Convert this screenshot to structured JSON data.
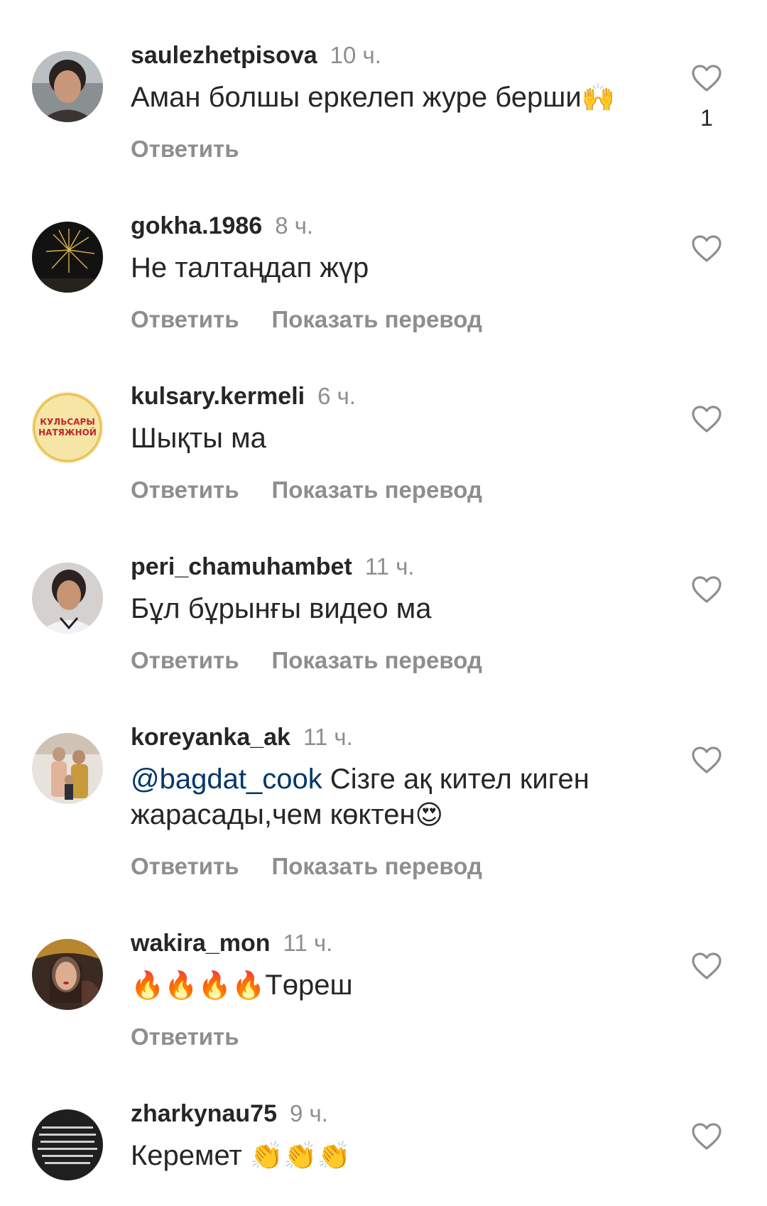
{
  "comments": [
    {
      "username": "saulezhetpisova",
      "time": "10 ч.",
      "text": "Аман болшы еркелеп журе берши",
      "emoji": "🙌",
      "reply_label": "Ответить",
      "like_count": "1"
    },
    {
      "username": "gokha.1986",
      "time": "8 ч.",
      "text": "Не талтаңдап жүр",
      "reply_label": "Ответить",
      "translate_label": "Показать перевод"
    },
    {
      "username": "kulsary.kermeli",
      "time": "6 ч.",
      "text": "Шықты ма",
      "reply_label": "Ответить",
      "translate_label": "Показать перевод",
      "avatar_text_line1": "КУЛЬСАРЫ",
      "avatar_text_line2": "НАТЯЖНОЙ"
    },
    {
      "username": "peri_chamuhambet",
      "time": "11 ч.",
      "text": "Бұл бұрынғы видео ма",
      "reply_label": "Ответить",
      "translate_label": "Показать перевод"
    },
    {
      "username": "koreyanka_ak",
      "time": "11 ч.",
      "mention": "@bagdat_cook",
      "text": " Сізге ақ кител киген жарасады,чем көктен",
      "emoji": "😍",
      "reply_label": "Ответить",
      "translate_label": "Показать перевод"
    },
    {
      "username": "wakira_mon",
      "time": "11 ч.",
      "emoji": "🔥🔥🔥🔥",
      "text": "Төреш",
      "reply_label": "Ответить"
    },
    {
      "username": "zharkynau75",
      "time": "9 ч.",
      "text": "Керемет ",
      "emoji": "👏👏👏"
    }
  ],
  "colors": {
    "primary_text": "#262626",
    "secondary_text": "#8e8e8e",
    "mention": "#00376b",
    "background": "#ffffff"
  },
  "icons": {
    "like": "heart-outline-icon"
  }
}
